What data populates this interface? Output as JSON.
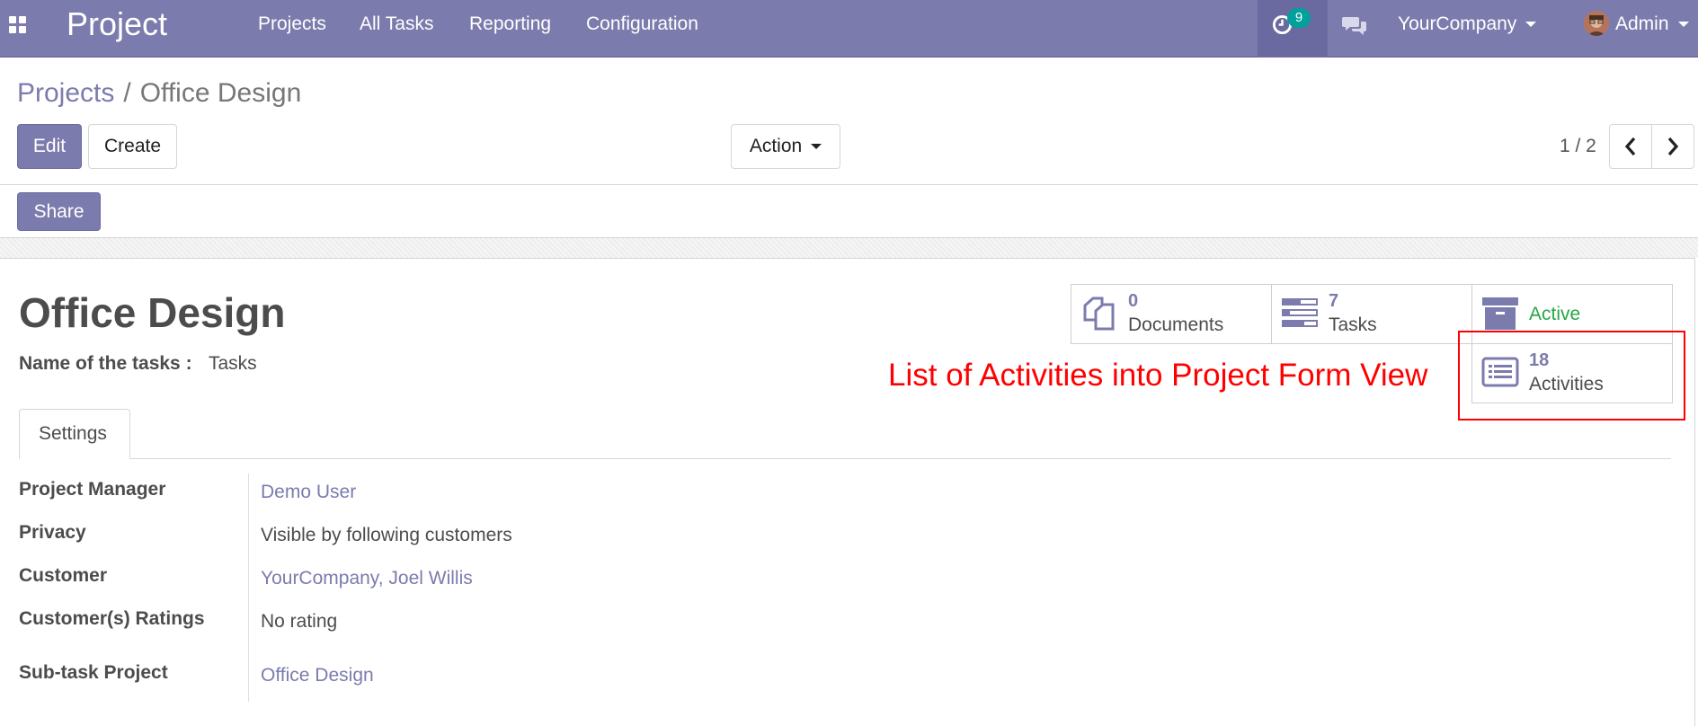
{
  "navbar": {
    "brand": "Project",
    "menu": [
      "Projects",
      "All Tasks",
      "Reporting",
      "Configuration"
    ],
    "activity_count": "9",
    "company": "YourCompany",
    "user": "Admin",
    "color": "#7c7bad"
  },
  "breadcrumb": {
    "parent": "Projects",
    "separator": "/",
    "current": "Office Design"
  },
  "toolbar": {
    "edit": "Edit",
    "create": "Create",
    "action": "Action",
    "share": "Share"
  },
  "pager": {
    "value": "1 / 2"
  },
  "record": {
    "title": "Office Design",
    "task_name_label": "Name of the tasks :",
    "task_name_value": "Tasks"
  },
  "smart_buttons": {
    "documents": {
      "count": "0",
      "label": "Documents",
      "icon": "documents-icon"
    },
    "tasks": {
      "count": "7",
      "label": "Tasks",
      "icon": "tasks-icon"
    },
    "active": {
      "label": "Active",
      "icon": "archive-icon"
    },
    "activities": {
      "count": "18",
      "label": "Activities",
      "icon": "activities-list-icon"
    }
  },
  "annotation": "List of Activities into Project Form View",
  "tabs": [
    "Settings"
  ],
  "fields": {
    "project_manager": {
      "label": "Project Manager",
      "value": "Demo User"
    },
    "privacy": {
      "label": "Privacy",
      "value": "Visible by following customers"
    },
    "customer": {
      "label": "Customer",
      "value": "YourCompany, Joel Willis"
    },
    "ratings": {
      "label": "Customer(s) Ratings",
      "value": "No rating"
    },
    "subtask": {
      "label": "Sub-task Project",
      "value": "Office Design"
    }
  }
}
